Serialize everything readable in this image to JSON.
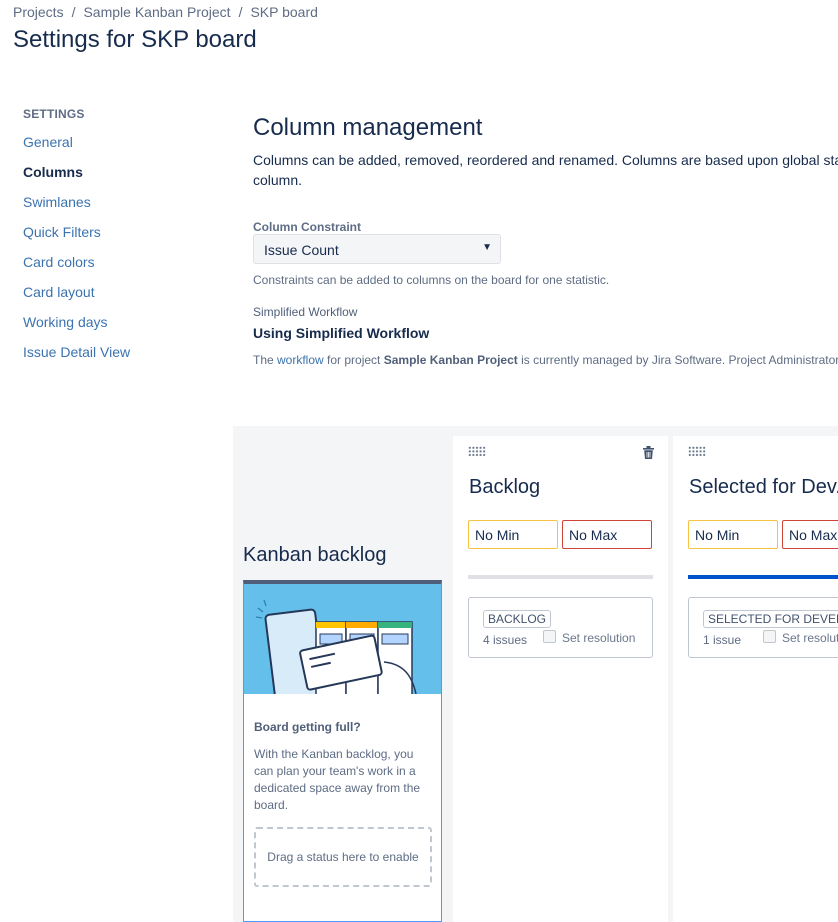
{
  "breadcrumbs": [
    "Projects",
    "Sample Kanban Project",
    "SKP board"
  ],
  "breadcrumb_separator": "/",
  "page_title": "Settings for SKP board",
  "sidebar": {
    "heading": "SETTINGS",
    "items": [
      {
        "label": "General"
      },
      {
        "label": "Columns",
        "active": true
      },
      {
        "label": "Swimlanes"
      },
      {
        "label": "Quick Filters"
      },
      {
        "label": "Card colors"
      },
      {
        "label": "Card layout"
      },
      {
        "label": "Working days"
      },
      {
        "label": "Issue Detail View"
      }
    ]
  },
  "main": {
    "title": "Column management",
    "description": "Columns can be added, removed, reordered and renamed. Columns are based upon global stat column.",
    "constraint": {
      "label": "Column Constraint",
      "value": "Issue Count",
      "help": "Constraints can be added to columns on the board for one statistic."
    },
    "workflow": {
      "label": "Simplified Workflow",
      "title": "Using Simplified Workflow",
      "text_1": "The ",
      "link": "workflow",
      "text_2": " for project ",
      "project": "Sample Kanban Project",
      "text_3": " is currently managed by Jira Software. Project Administrators"
    }
  },
  "backlog": {
    "title": "Kanban backlog",
    "card_title": "Board getting full?",
    "card_text": "With the Kanban backlog, you can plan your team's work in a dedicated space away from the board.",
    "dropzone": "Drag a status here to enable"
  },
  "columns": [
    {
      "name": "Backlog",
      "min": "No Min",
      "max": "No Max",
      "status": "BACKLOG",
      "issues": "4 issues",
      "resolution": "Set resolution"
    },
    {
      "name": "Selected for Dev...",
      "min": "No Min",
      "max": "No Max",
      "status": "SELECTED FOR DEVEL...",
      "issues": "1 issue",
      "resolution": "Set resolution"
    }
  ],
  "icons": {
    "trash": "trash-icon",
    "grip": "drag-handle-icon",
    "caret": "caret-down-icon"
  },
  "colors": {
    "link": "#3b73af",
    "text": "#172b4d",
    "min_border": "#f6c342",
    "max_border": "#d04437",
    "accent": "#0052cc"
  }
}
